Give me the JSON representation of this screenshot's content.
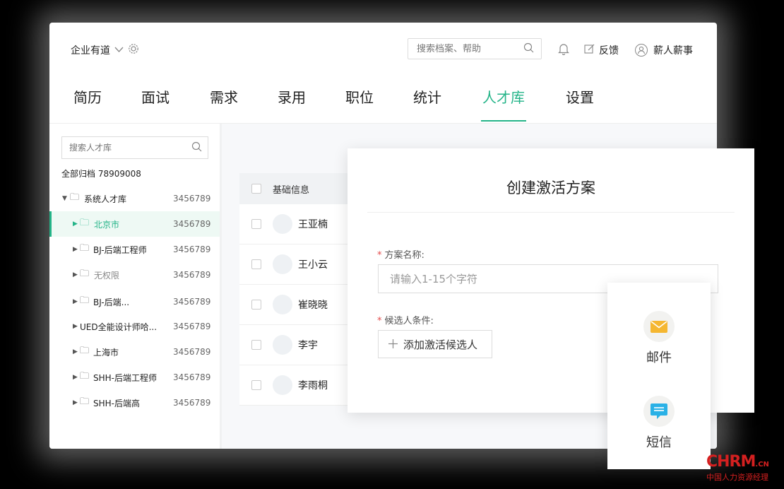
{
  "header": {
    "company": "企业有道",
    "search_placeholder": "搜索档案、帮助",
    "feedback": "反馈",
    "user": "薪人薪事"
  },
  "nav": {
    "tabs": [
      "简历",
      "面试",
      "需求",
      "录用",
      "职位",
      "统计",
      "人才库",
      "设置"
    ],
    "active": "人才库"
  },
  "sidebar": {
    "search_placeholder": "搜索人才库",
    "all_label": "全部归档 78909008",
    "items": [
      {
        "name": "系统人才库",
        "count": "3456789"
      },
      {
        "name": "北京市",
        "count": "3456789"
      },
      {
        "name": "BJ-后端工程师",
        "count": "3456789"
      },
      {
        "name": "无权限",
        "count": "3456789"
      },
      {
        "name": "BJ-后端...",
        "count": "3456789"
      },
      {
        "name": "UED全能设计师哈...",
        "count": "3456789"
      },
      {
        "name": "上海市",
        "count": "3456789"
      },
      {
        "name": "SHH-后端工程师",
        "count": "3456789"
      },
      {
        "name": "SHH-后端高",
        "count": "3456789"
      }
    ]
  },
  "list": {
    "header": "基础信息",
    "rows": [
      "王亚楠",
      "王小云",
      "崔晓晓",
      "李宇",
      "李雨桐"
    ]
  },
  "modal": {
    "title": "创建激活方案",
    "name_label": "方案名称:",
    "name_placeholder": "请输入1-15个字符",
    "cond_label": "候选人条件:",
    "add_button": "添加激活候选人"
  },
  "channels": {
    "email": "邮件",
    "sms": "短信"
  },
  "colors": {
    "accent": "#24b488",
    "email_icon": "#f5b731",
    "sms_icon": "#2ab1e6"
  },
  "watermark": {
    "brand": "CHRM",
    "suffix": ".CN",
    "tagline": "中国人力资源经理"
  }
}
